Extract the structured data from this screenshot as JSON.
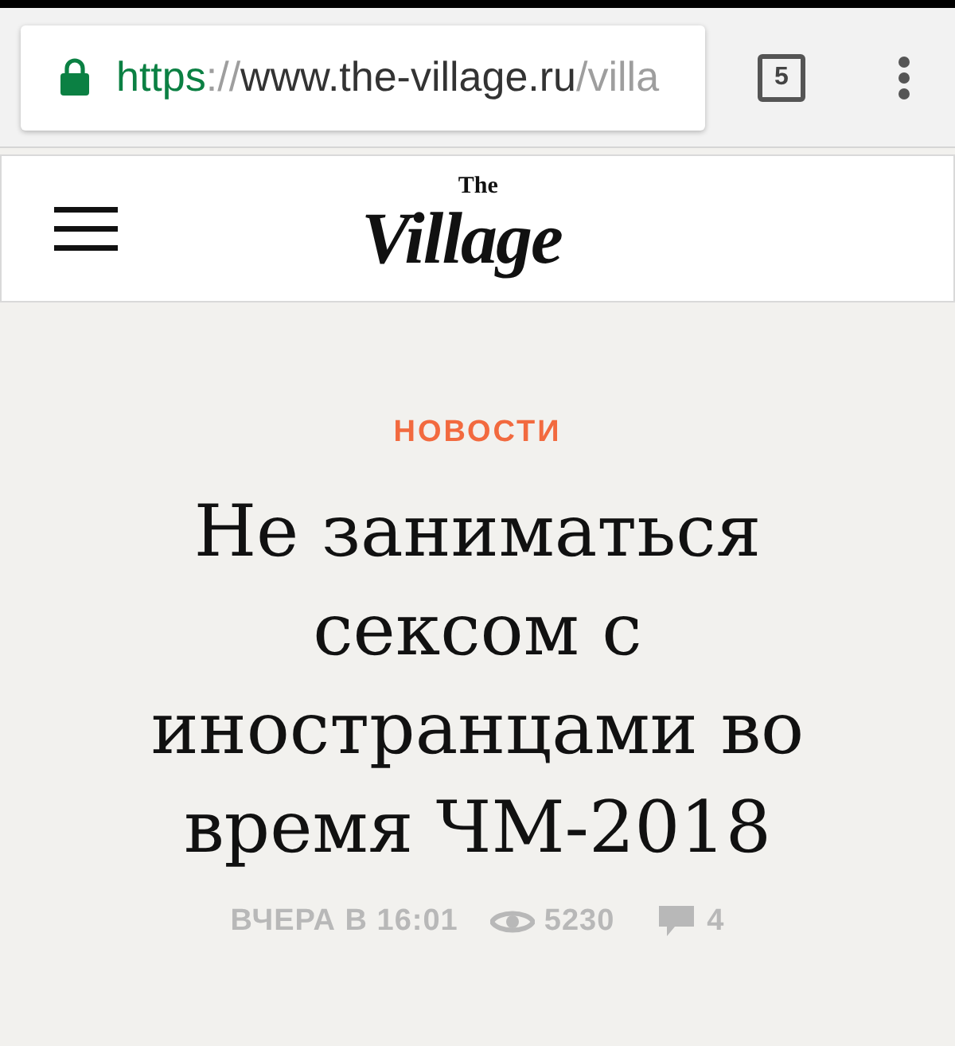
{
  "browser": {
    "url_parts": [
      {
        "kind": "scheme",
        "text": "https"
      },
      {
        "kind": "separator",
        "text": "://"
      },
      {
        "kind": "host",
        "text": "www.the-village.ru"
      },
      {
        "kind": "path",
        "text": "/villa"
      }
    ],
    "secure": true,
    "tab_count": "5"
  },
  "site_header": {
    "logo": {
      "main": "Village",
      "small": "The"
    }
  },
  "article": {
    "category": "НОВОСТИ",
    "headline": "Не заниматься сексом с иностранцами во время ЧМ-2018",
    "date": "ВЧЕРА В 16:01",
    "views": "5230",
    "comments": "4"
  }
}
